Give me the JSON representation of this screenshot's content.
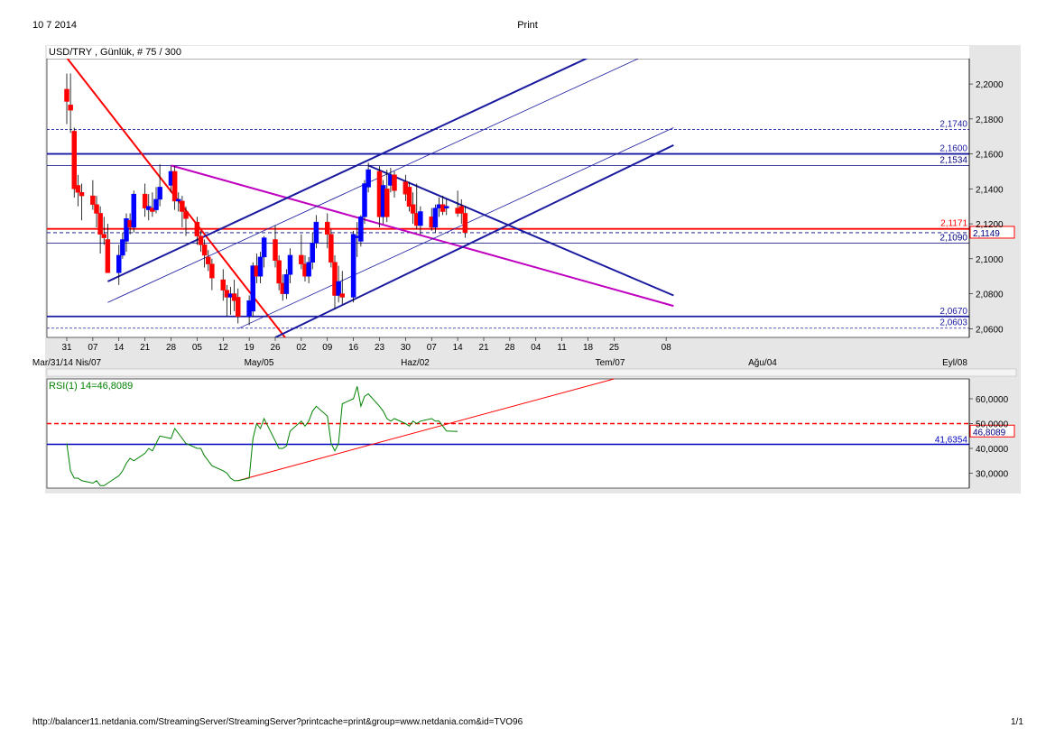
{
  "page": {
    "date": "10 7 2014",
    "title": "Print",
    "url": "http://balancer11.netdania.com/StreamingServer/StreamingServer?printcache=print&group=www.netdania.com&id=TVO96",
    "page_number": "1/1"
  },
  "chart_data": [
    {
      "type": "candlestick",
      "title": "USD/TRY , Günlük, # 75 / 300",
      "ylim": [
        2.055,
        2.2145
      ],
      "y_ticks": [
        "2,2000",
        "2,1800",
        "2,1600",
        "2,1400",
        "2,1200",
        "2,1000",
        "2,0800",
        "2,0600"
      ],
      "x_day_ticks": [
        "31",
        "07",
        "14",
        "21",
        "28",
        "05",
        "12",
        "19",
        "26",
        "02",
        "09",
        "16",
        "23",
        "30",
        "07",
        "14",
        "21",
        "28",
        "04",
        "11",
        "18",
        "25",
        "08"
      ],
      "x_month_labels": [
        "Mar/31/14 Nis/07",
        "May/05",
        "Haz/02",
        "Tem/07",
        "Ağu/04",
        "Eyl/08"
      ],
      "price_levels": [
        {
          "label": "2,1740",
          "value": 2.174,
          "color": "#1a1aa0",
          "style": "dashed"
        },
        {
          "label": "2,1600",
          "value": 2.16,
          "color": "#1a1aa0",
          "style": "solid"
        },
        {
          "label": "2,1534",
          "value": 2.1534,
          "color": "#000080",
          "style": "thin"
        },
        {
          "label": "2,1171",
          "value": 2.1171,
          "color": "#ff0000",
          "style": "solid"
        },
        {
          "label": "2,1090",
          "value": 2.109,
          "color": "#000080",
          "style": "thin"
        },
        {
          "label": "2,0670",
          "value": 2.067,
          "color": "#1a1aa0",
          "style": "solid"
        },
        {
          "label": "2,0603",
          "value": 2.0603,
          "color": "#1a1aa0",
          "style": "dashed"
        }
      ],
      "current_price": {
        "label": "2,1149",
        "value": 2.1149
      },
      "series": [
        {
          "name": "USD/TRY",
          "colors": {
            "up": "#0000ff",
            "down": "#ff0000"
          },
          "ohlc": [
            {
              "date": "2014-03-31",
              "o": 2.197,
              "h": 2.206,
              "l": 2.177,
              "c": 2.19
            },
            {
              "date": "2014-04-01",
              "o": 2.188,
              "h": 2.206,
              "l": 2.172,
              "c": 2.185
            },
            {
              "date": "2014-04-02",
              "o": 2.173,
              "h": 2.175,
              "l": 2.135,
              "c": 2.14
            },
            {
              "date": "2014-04-03",
              "o": 2.142,
              "h": 2.148,
              "l": 2.13,
              "c": 2.138
            },
            {
              "date": "2014-04-04",
              "o": 2.138,
              "h": 2.143,
              "l": 2.122,
              "c": 2.136
            },
            {
              "date": "2014-04-07",
              "o": 2.136,
              "h": 2.145,
              "l": 2.128,
              "c": 2.131
            },
            {
              "date": "2014-04-08",
              "o": 2.131,
              "h": 2.136,
              "l": 2.118,
              "c": 2.126
            },
            {
              "date": "2014-04-09",
              "o": 2.126,
              "h": 2.13,
              "l": 2.103,
              "c": 2.114
            },
            {
              "date": "2014-04-10",
              "o": 2.114,
              "h": 2.124,
              "l": 2.108,
              "c": 2.112
            },
            {
              "date": "2014-04-11",
              "o": 2.111,
              "h": 2.12,
              "l": 2.098,
              "c": 2.092
            },
            {
              "date": "2014-04-14",
              "o": 2.092,
              "h": 2.108,
              "l": 2.085,
              "c": 2.102
            },
            {
              "date": "2014-04-15",
              "o": 2.102,
              "h": 2.115,
              "l": 2.1,
              "c": 2.111
            },
            {
              "date": "2014-04-16",
              "o": 2.11,
              "h": 2.126,
              "l": 2.104,
              "c": 2.123
            },
            {
              "date": "2014-04-17",
              "o": 2.122,
              "h": 2.126,
              "l": 2.114,
              "c": 2.118
            },
            {
              "date": "2014-04-18",
              "o": 2.118,
              "h": 2.139,
              "l": 2.115,
              "c": 2.137
            },
            {
              "date": "2014-04-21",
              "o": 2.137,
              "h": 2.143,
              "l": 2.124,
              "c": 2.129
            },
            {
              "date": "2014-04-22",
              "o": 2.128,
              "h": 2.137,
              "l": 2.122,
              "c": 2.13
            },
            {
              "date": "2014-04-23",
              "o": 2.129,
              "h": 2.138,
              "l": 2.124,
              "c": 2.127
            },
            {
              "date": "2014-04-24",
              "o": 2.128,
              "h": 2.141,
              "l": 2.126,
              "c": 2.134
            },
            {
              "date": "2014-04-25",
              "o": 2.134,
              "h": 2.154,
              "l": 2.13,
              "c": 2.141
            },
            {
              "date": "2014-04-28",
              "o": 2.142,
              "h": 2.153,
              "l": 2.138,
              "c": 2.15
            },
            {
              "date": "2014-04-29",
              "o": 2.15,
              "h": 2.153,
              "l": 2.128,
              "c": 2.133
            },
            {
              "date": "2014-04-30",
              "o": 2.133,
              "h": 2.138,
              "l": 2.127,
              "c": 2.134
            },
            {
              "date": "2014-05-01",
              "o": 2.133,
              "h": 2.136,
              "l": 2.118,
              "c": 2.127
            },
            {
              "date": "2014-05-02",
              "o": 2.127,
              "h": 2.13,
              "l": 2.113,
              "c": 2.123
            },
            {
              "date": "2014-05-05",
              "o": 2.121,
              "h": 2.124,
              "l": 2.108,
              "c": 2.113
            },
            {
              "date": "2014-05-06",
              "o": 2.113,
              "h": 2.116,
              "l": 2.104,
              "c": 2.108
            },
            {
              "date": "2014-05-07",
              "o": 2.108,
              "h": 2.111,
              "l": 2.095,
              "c": 2.102
            },
            {
              "date": "2014-05-08",
              "o": 2.101,
              "h": 2.105,
              "l": 2.093,
              "c": 2.097
            },
            {
              "date": "2014-05-09",
              "o": 2.097,
              "h": 2.1,
              "l": 2.082,
              "c": 2.089
            },
            {
              "date": "2014-05-12",
              "o": 2.088,
              "h": 2.094,
              "l": 2.076,
              "c": 2.082
            },
            {
              "date": "2014-05-13",
              "o": 2.082,
              "h": 2.085,
              "l": 2.067,
              "c": 2.078
            },
            {
              "date": "2014-05-14",
              "o": 2.078,
              "h": 2.084,
              "l": 2.068,
              "c": 2.08
            },
            {
              "date": "2014-05-15",
              "o": 2.08,
              "h": 2.088,
              "l": 2.07,
              "c": 2.076
            },
            {
              "date": "2014-05-16",
              "o": 2.078,
              "h": 2.083,
              "l": 2.063,
              "c": 2.067
            },
            {
              "date": "2014-05-19",
              "o": 2.067,
              "h": 2.079,
              "l": 2.062,
              "c": 2.076
            },
            {
              "date": "2014-05-20",
              "o": 2.07,
              "h": 2.098,
              "l": 2.067,
              "c": 2.096
            },
            {
              "date": "2014-05-21",
              "o": 2.096,
              "h": 2.103,
              "l": 2.086,
              "c": 2.09
            },
            {
              "date": "2014-05-22",
              "o": 2.09,
              "h": 2.104,
              "l": 2.086,
              "c": 2.101
            },
            {
              "date": "2014-05-23",
              "o": 2.101,
              "h": 2.113,
              "l": 2.095,
              "c": 2.112
            },
            {
              "date": "2014-05-26",
              "o": 2.111,
              "h": 2.119,
              "l": 2.095,
              "c": 2.099
            },
            {
              "date": "2014-05-27",
              "o": 2.099,
              "h": 2.102,
              "l": 2.082,
              "c": 2.086
            },
            {
              "date": "2014-05-28",
              "o": 2.086,
              "h": 2.091,
              "l": 2.076,
              "c": 2.08
            },
            {
              "date": "2014-05-29",
              "o": 2.08,
              "h": 2.094,
              "l": 2.077,
              "c": 2.091
            },
            {
              "date": "2014-05-30",
              "o": 2.091,
              "h": 2.106,
              "l": 2.086,
              "c": 2.102
            },
            {
              "date": "2014-06-02",
              "o": 2.102,
              "h": 2.114,
              "l": 2.094,
              "c": 2.097
            },
            {
              "date": "2014-06-03",
              "o": 2.097,
              "h": 2.102,
              "l": 2.087,
              "c": 2.09
            },
            {
              "date": "2014-06-04",
              "o": 2.09,
              "h": 2.101,
              "l": 2.086,
              "c": 2.098
            },
            {
              "date": "2014-06-05",
              "o": 2.098,
              "h": 2.115,
              "l": 2.094,
              "c": 2.109
            },
            {
              "date": "2014-06-06",
              "o": 2.109,
              "h": 2.125,
              "l": 2.106,
              "c": 2.121
            },
            {
              "date": "2014-06-09",
              "o": 2.121,
              "h": 2.126,
              "l": 2.106,
              "c": 2.114
            },
            {
              "date": "2014-06-10",
              "o": 2.114,
              "h": 2.117,
              "l": 2.095,
              "c": 2.098
            },
            {
              "date": "2014-06-11",
              "o": 2.098,
              "h": 2.102,
              "l": 2.071,
              "c": 2.079
            },
            {
              "date": "2014-06-12",
              "o": 2.079,
              "h": 2.096,
              "l": 2.075,
              "c": 2.087
            },
            {
              "date": "2014-06-13",
              "o": 2.08,
              "h": 2.093,
              "l": 2.074,
              "c": 2.078
            },
            {
              "date": "2014-06-16",
              "o": 2.078,
              "h": 2.116,
              "l": 2.075,
              "c": 2.114
            },
            {
              "date": "2014-06-17",
              "o": 2.112,
              "h": 2.121,
              "l": 2.101,
              "c": 2.113
            },
            {
              "date": "2014-06-18",
              "o": 2.11,
              "h": 2.125,
              "l": 2.107,
              "c": 2.124
            },
            {
              "date": "2014-06-19",
              "o": 2.124,
              "h": 2.145,
              "l": 2.12,
              "c": 2.143
            },
            {
              "date": "2014-06-20",
              "o": 2.141,
              "h": 2.155,
              "l": 2.138,
              "c": 2.151
            },
            {
              "date": "2014-06-23",
              "o": 2.15,
              "h": 2.153,
              "l": 2.118,
              "c": 2.124
            },
            {
              "date": "2014-06-24",
              "o": 2.124,
              "h": 2.145,
              "l": 2.12,
              "c": 2.142
            },
            {
              "date": "2014-06-25",
              "o": 2.14,
              "h": 2.151,
              "l": 2.121,
              "c": 2.124
            },
            {
              "date": "2014-06-26",
              "o": 2.142,
              "h": 2.152,
              "l": 2.138,
              "c": 2.148
            },
            {
              "date": "2014-06-27",
              "o": 2.148,
              "h": 2.15,
              "l": 2.135,
              "c": 2.139
            },
            {
              "date": "2014-06-30",
              "o": 2.144,
              "h": 2.148,
              "l": 2.133,
              "c": 2.137
            },
            {
              "date": "2014-07-01",
              "o": 2.141,
              "h": 2.144,
              "l": 2.127,
              "c": 2.13
            },
            {
              "date": "2014-07-02",
              "o": 2.131,
              "h": 2.138,
              "l": 2.12,
              "c": 2.126
            },
            {
              "date": "2014-07-03",
              "o": 2.126,
              "h": 2.143,
              "l": 2.117,
              "c": 2.119
            },
            {
              "date": "2014-07-04",
              "o": 2.119,
              "h": 2.13,
              "l": 2.114,
              "c": 2.127
            },
            {
              "date": "2014-07-07",
              "o": 2.124,
              "h": 2.129,
              "l": 2.116,
              "c": 2.118
            },
            {
              "date": "2014-07-08",
              "o": 2.118,
              "h": 2.131,
              "l": 2.115,
              "c": 2.129
            },
            {
              "date": "2014-07-09",
              "o": 2.129,
              "h": 2.135,
              "l": 2.124,
              "c": 2.131
            },
            {
              "date": "2014-07-10",
              "o": 2.131,
              "h": 2.136,
              "l": 2.125,
              "c": 2.127
            },
            {
              "date": "2014-07-11",
              "o": 2.129,
              "h": 2.134,
              "l": 2.125,
              "c": 2.13
            },
            {
              "date": "2014-07-14",
              "o": 2.129,
              "h": 2.139,
              "l": 2.124,
              "c": 2.126
            },
            {
              "date": "2014-07-15",
              "o": 2.13,
              "h": 2.134,
              "l": 2.12,
              "c": 2.126
            },
            {
              "date": "2014-07-16",
              "o": 2.126,
              "h": 2.13,
              "l": 2.112,
              "c": 2.115
            }
          ]
        }
      ],
      "trend_lines": [
        {
          "color": "#ff0000",
          "from": {
            "date": "2014-03-31",
            "price": 2.215
          },
          "to": {
            "date": "2014-05-29",
            "price": 2.054
          }
        },
        {
          "color": "#c000c0",
          "from": {
            "date": "2014-04-28",
            "price": 2.1534
          },
          "to": {
            "date": "2014-09-10",
            "price": 2.073
          }
        },
        {
          "color": "#1a1aa0",
          "from": {
            "date": "2014-06-20",
            "price": 2.1534
          },
          "to": {
            "date": "2014-09-10",
            "price": 2.079
          }
        },
        {
          "color": "#1a1aa0",
          "from": {
            "date": "2014-04-11",
            "price": 2.087
          },
          "to": {
            "date": "2014-08-18",
            "price": 2.215
          }
        },
        {
          "color": "#1a1aa0",
          "from": {
            "date": "2014-04-11",
            "price": 2.075
          },
          "to": {
            "date": "2014-09-01",
            "price": 2.215
          }
        },
        {
          "color": "#1a1aa0",
          "from": {
            "date": "2014-05-16",
            "price": 2.06
          },
          "to": {
            "date": "2014-09-10",
            "price": 2.175
          }
        },
        {
          "color": "#1a1aa0",
          "from": {
            "date": "2014-05-26",
            "price": 2.055
          },
          "to": {
            "date": "2014-09-10",
            "price": 2.165
          }
        }
      ]
    },
    {
      "type": "line",
      "title": "RSI(1) 14=46,8089",
      "ylim": [
        24,
        68
      ],
      "y_ticks": [
        "60,0000",
        "50,0000",
        "40,0000",
        "30,0000"
      ],
      "levels": [
        {
          "value": 50,
          "color": "#ff0000",
          "style": "dashed"
        },
        {
          "value": 41.6354,
          "label": "41,6354",
          "color": "#0000c0",
          "style": "solid"
        }
      ],
      "current": {
        "label": "46,8089",
        "value": 46.8089
      },
      "trend_line": {
        "color": "#ff0000",
        "from": {
          "date": "2014-05-16",
          "value": 27
        },
        "to": {
          "date": "2014-08-25",
          "value": 68
        }
      },
      "series": [
        {
          "name": "RSI",
          "color": "#008000",
          "values": [
            42,
            31,
            28,
            28,
            27,
            26,
            27,
            25,
            25,
            26,
            29,
            31,
            34,
            36,
            35,
            38,
            40,
            39,
            42,
            45,
            44,
            48,
            46,
            44,
            42,
            40,
            40,
            37,
            35,
            33,
            31,
            30,
            28,
            27,
            27,
            28,
            44,
            50,
            48,
            52,
            43,
            40,
            40,
            41,
            47,
            51,
            49,
            51,
            55,
            57,
            53,
            42,
            39,
            42,
            58,
            60,
            65,
            57,
            61,
            62,
            57,
            55,
            52,
            51,
            52,
            50,
            49,
            51,
            50,
            51,
            52,
            51,
            51,
            49,
            47,
            46.8089
          ]
        }
      ]
    }
  ]
}
